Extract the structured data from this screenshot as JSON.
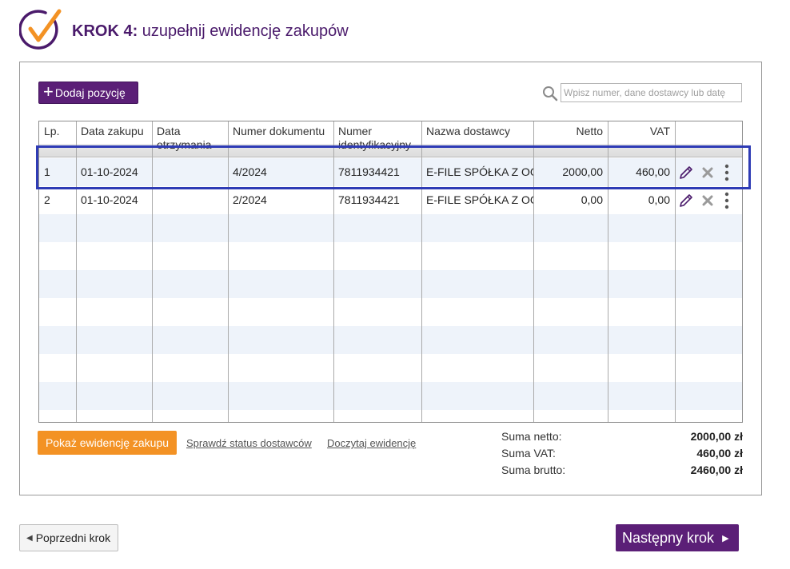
{
  "header": {
    "step": "KROK 4:",
    "title": "uzupełnij ewidencję zakupów"
  },
  "toolbar": {
    "add_label": "Dodaj pozycję",
    "search_placeholder": "Wpisz numer, dane dostawcy lub datę"
  },
  "table": {
    "columns": [
      "Lp.",
      "Data zakupu",
      "Data otrzymania",
      "Numer dokumentu",
      "Numer identyfikacyjny",
      "Nazwa dostawcy",
      "Netto",
      "VAT"
    ],
    "rows": [
      {
        "lp": "1",
        "data_zakupu": "01-10-2024",
        "data_otrzymania": "",
        "numer_dokumentu": "4/2024",
        "numer_id": "7811934421",
        "nazwa": "E-FILE SPÓŁKA Z OGRANICZONĄ",
        "netto": "2000,00",
        "vat": "460,00"
      },
      {
        "lp": "2",
        "data_zakupu": "01-10-2024",
        "data_otrzymania": "",
        "numer_dokumentu": "2/2024",
        "numer_id": "7811934421",
        "nazwa": "E-FILE SPÓŁKA Z OGRANICZONĄ",
        "netto": "0,00",
        "vat": "0,00"
      }
    ]
  },
  "footer": {
    "show_button": "Pokaż ewidencję zakupu",
    "link_status": "Sprawdź status dostawców",
    "link_reload": "Doczytaj ewidencję",
    "sums": [
      {
        "label": "Suma netto:",
        "value": "2000,00 zł"
      },
      {
        "label": "Suma VAT:",
        "value": "460,00 zł"
      },
      {
        "label": "Suma brutto:",
        "value": "2460,00 zł"
      }
    ]
  },
  "nav": {
    "prev": "Poprzedni krok",
    "next": "Następny krok"
  },
  "colors": {
    "brand_purple": "#5b1f77",
    "accent_orange": "#f39224",
    "highlight_blue": "#2e3bb5"
  },
  "icons": [
    "checkmark-logo-icon",
    "plus-icon",
    "search-icon",
    "pencil-icon",
    "close-icon",
    "more-vertical-icon",
    "triangle-left-icon",
    "triangle-right-icon"
  ]
}
